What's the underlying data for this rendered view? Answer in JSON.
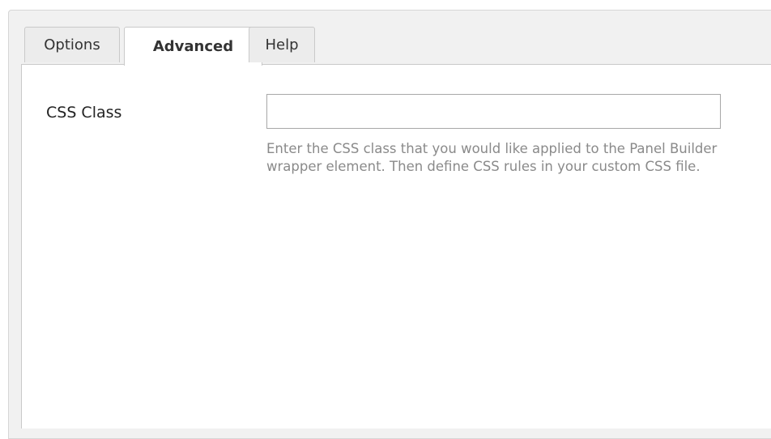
{
  "tabs": [
    {
      "label": "Options"
    },
    {
      "label": "Advanced",
      "active": true
    },
    {
      "label": "Help"
    }
  ],
  "form": {
    "css_class_label": "CSS Class",
    "css_class_value": "",
    "css_class_help": "Enter the CSS class that you would like applied to the Panel Builder wrapper element. Then define CSS rules in your custom CSS file."
  }
}
